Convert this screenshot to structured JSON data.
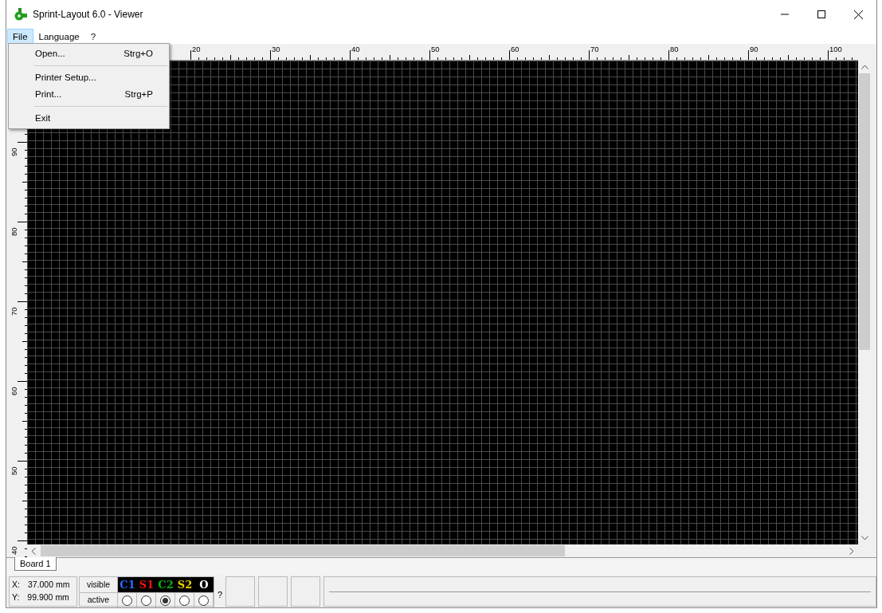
{
  "window": {
    "title": "Sprint-Layout 6.0 - Viewer"
  },
  "menu_bar": [
    {
      "label": "File",
      "selected": true
    },
    {
      "label": "Language",
      "selected": false
    },
    {
      "label": "?",
      "selected": false
    }
  ],
  "file_menu": {
    "items": [
      {
        "kind": "item",
        "label": "Open...",
        "shortcut": "Strg+O"
      },
      {
        "kind": "separator"
      },
      {
        "kind": "item",
        "label": "Printer Setup..."
      },
      {
        "kind": "item",
        "label": "Print...",
        "shortcut": "Strg+P"
      },
      {
        "kind": "separator"
      },
      {
        "kind": "item",
        "label": "Exit"
      }
    ]
  },
  "ruler_top": {
    "labels": [
      "20",
      "30",
      "40",
      "50",
      "60",
      "70",
      "80",
      "90",
      "100"
    ]
  },
  "ruler_left": {
    "labels": [
      "90",
      "80",
      "70",
      "60",
      "50",
      "40"
    ]
  },
  "tabs": [
    {
      "label": "Board 1",
      "selected": true
    }
  ],
  "status_bar": {
    "coordinates": [
      {
        "axis": "X:",
        "value": "37.000 mm"
      },
      {
        "axis": "Y:",
        "value": "99.900 mm"
      }
    ],
    "row_labels": [
      "visible",
      "active"
    ],
    "layers": [
      {
        "name": "C1",
        "color": "#2a6cff",
        "selected": false
      },
      {
        "name": "S1",
        "color": "#ff1010",
        "selected": false
      },
      {
        "name": "C2",
        "color": "#10b010",
        "selected": true
      },
      {
        "name": "S2",
        "color": "#e8d000",
        "selected": false
      },
      {
        "name": "O",
        "color": "#ffffff",
        "selected": false
      }
    ],
    "help": "?"
  }
}
